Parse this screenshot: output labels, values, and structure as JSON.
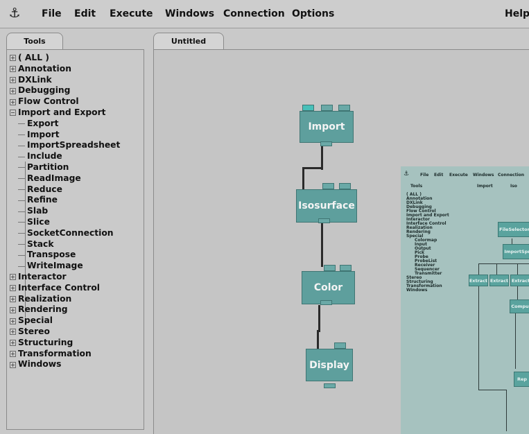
{
  "menubar": {
    "items": [
      "File",
      "Edit",
      "Execute",
      "Windows",
      "Connection",
      "Options",
      "Help"
    ]
  },
  "tools": {
    "tab_label": "Tools",
    "tree": [
      {
        "label": "( ALL )",
        "expanded": false
      },
      {
        "label": "Annotation",
        "expanded": false
      },
      {
        "label": "DXLink",
        "expanded": false
      },
      {
        "label": "Debugging",
        "expanded": false
      },
      {
        "label": "Flow Control",
        "expanded": false
      },
      {
        "label": "Import and Export",
        "expanded": true,
        "children": [
          "Export",
          "Import",
          "ImportSpreadsheet",
          "Include",
          "Partition",
          "ReadImage",
          "Reduce",
          "Refine",
          "Slab",
          "Slice",
          "SocketConnection",
          "Stack",
          "Transpose",
          "WriteImage"
        ]
      },
      {
        "label": "Interactor",
        "expanded": false
      },
      {
        "label": "Interface Control",
        "expanded": false
      },
      {
        "label": "Realization",
        "expanded": false
      },
      {
        "label": "Rendering",
        "expanded": false
      },
      {
        "label": "Special",
        "expanded": false
      },
      {
        "label": "Stereo",
        "expanded": false
      },
      {
        "label": "Structuring",
        "expanded": false
      },
      {
        "label": "Transformation",
        "expanded": false
      },
      {
        "label": "Windows",
        "expanded": false
      }
    ]
  },
  "canvas": {
    "tab_label": "Untitled",
    "modules": [
      "Import",
      "Isosurface",
      "Color",
      "Display"
    ]
  },
  "inset": {
    "menu": [
      "File",
      "Edit",
      "Execute",
      "Windows",
      "Connection"
    ],
    "tabs": [
      "Tools",
      "Import",
      "Iso"
    ],
    "tree": [
      "( ALL )",
      "Annotation",
      "DXLink",
      "Debugging",
      "Flow Control",
      "Import and Export",
      "Interactor",
      "Interface Control",
      "Realization",
      "Rendering",
      "Special",
      "Colormap",
      "Input",
      "Output",
      "Pick",
      "Probe",
      "ProbeList",
      "Receiver",
      "Sequencer",
      "Transmitter",
      "Stereo",
      "Structuring",
      "Transformation",
      "Windows"
    ],
    "modules": [
      "FileSelector",
      "ImportSpr",
      "Extract",
      "Extract",
      "Extract",
      "Compu",
      "Rep"
    ]
  },
  "colors": {
    "module_fill": "#5e9f9d",
    "module_active_port": "#48c0b9",
    "background": "#c9c9c9"
  }
}
